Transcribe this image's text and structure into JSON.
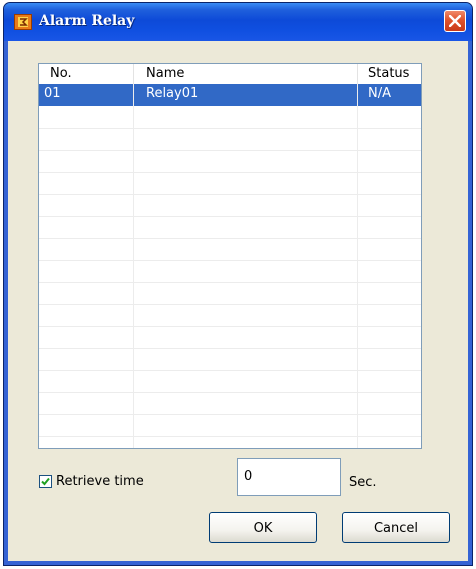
{
  "window": {
    "title": "Alarm Relay",
    "icon": "app-icon",
    "close_icon": "close-icon"
  },
  "list": {
    "columns": [
      "No.",
      "Name",
      "Status"
    ],
    "rows": [
      {
        "no": "01",
        "name": "Relay01",
        "status": "N/A",
        "selected": true
      }
    ]
  },
  "retrieve": {
    "checkbox_label": "Retrieve time",
    "checked": true,
    "value": "0",
    "unit": "Sec."
  },
  "buttons": {
    "ok": "OK",
    "cancel": "Cancel"
  },
  "colors": {
    "titlebar": "#0d4ad8",
    "selection": "#3169c6",
    "client_bg": "#ece9d8",
    "close": "#e0532c"
  }
}
